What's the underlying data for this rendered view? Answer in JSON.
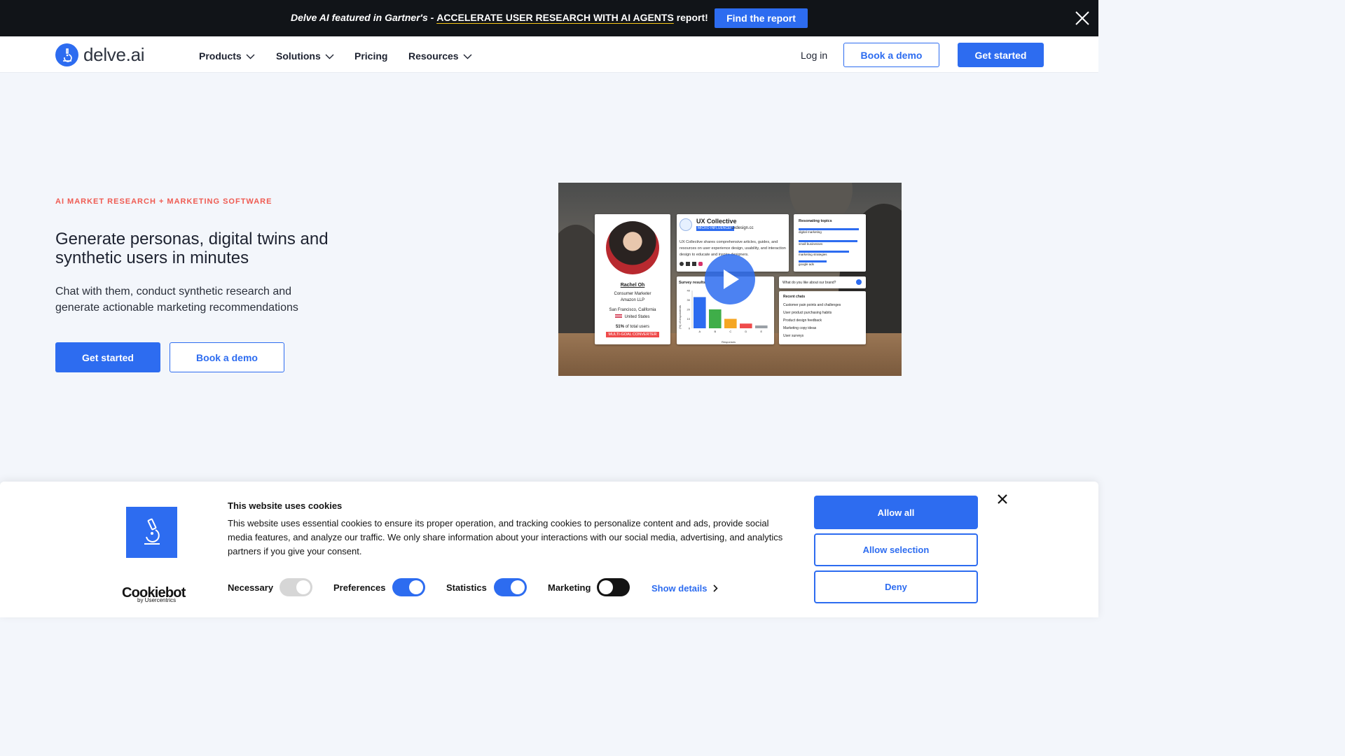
{
  "banner": {
    "text_prefix": "Delve AI featured in Gartner's - ",
    "link_text": "ACCELERATE USER RESEARCH WITH AI AGENTS",
    "text_suffix": " report!",
    "button_label": "Find the report",
    "close_icon": "close-icon"
  },
  "nav": {
    "logo_text": "delve.ai",
    "items": [
      {
        "label": "Products",
        "has_dropdown": true
      },
      {
        "label": "Solutions",
        "has_dropdown": true
      },
      {
        "label": "Pricing",
        "has_dropdown": false
      },
      {
        "label": "Resources",
        "has_dropdown": true
      }
    ],
    "login_label": "Log in",
    "demo_label": "Book a demo",
    "start_label": "Get started"
  },
  "hero": {
    "eyebrow": "AI MARKET RESEARCH + MARKETING SOFTWARE",
    "headline": "Generate personas, digital twins and synthetic users in minutes",
    "subhead": "Chat with them, conduct synthetic research and generate actionable marketing recommendations",
    "start_label": "Get started",
    "demo_label": "Book a demo"
  },
  "video": {
    "persona": {
      "name": "Rachel Oh",
      "role": "Consumer Marketer",
      "company": "Amazon LLP",
      "location": "San Francisco, California",
      "country": "United States",
      "share_bold": "51%",
      "share_rest": " of total users",
      "badge": "MULTI-GOAL CONVERTER"
    },
    "ux": {
      "title": "UX Collective",
      "tag": "MICRO INFLUENCER",
      "domain": "uxdesign.cc",
      "desc": "UX Collective shares comprehensive articles, guides, and resources on user experience design, usability, and interaction design to educate and inspire designers."
    },
    "topics": {
      "title": "Resonating topics",
      "items": [
        "digital marketing",
        "small businesses",
        "marketing strategies",
        "google ads"
      ]
    },
    "survey": {
      "title": "Survey results",
      "ylabel": "(%) of respondents",
      "xlabel": "Responses",
      "y_ticks": [
        "40",
        "30",
        "20",
        "10",
        "0"
      ],
      "categories": [
        "A",
        "B",
        "C",
        "D",
        "E"
      ],
      "values": [
        33,
        20,
        10,
        5,
        3
      ],
      "colors": [
        "#2d6cf0",
        "#3fae49",
        "#f5a623",
        "#ef4b4b",
        "#9aa0a6"
      ]
    },
    "chat": {
      "prompt": "What do you like about our brand?",
      "recent_title": "Recent chats",
      "recent": [
        "Customer pain points and challenges",
        "User product purchasing habits",
        "Product design feedback",
        "Marketing copy ideas",
        "User surveys"
      ]
    },
    "play_icon": "play-icon"
  },
  "cookie": {
    "title": "This website uses cookies",
    "body": "This website uses essential cookies to ensure its proper operation, and tracking cookies to personalize content and ads, provide social media features, and analyze our traffic. We only share information about your interactions with our social media, advertising, and analytics partners if you give your consent.",
    "brand": "Cookiebot",
    "brand_sub": "by Usercentrics",
    "toggles": [
      {
        "label": "Necessary",
        "on": true,
        "disabled": true
      },
      {
        "label": "Preferences",
        "on": true,
        "disabled": false
      },
      {
        "label": "Statistics",
        "on": true,
        "disabled": false
      },
      {
        "label": "Marketing",
        "on": false,
        "disabled": false
      }
    ],
    "show_details": "Show details",
    "allow_all": "Allow all",
    "allow_selection": "Allow selection",
    "deny": "Deny"
  }
}
